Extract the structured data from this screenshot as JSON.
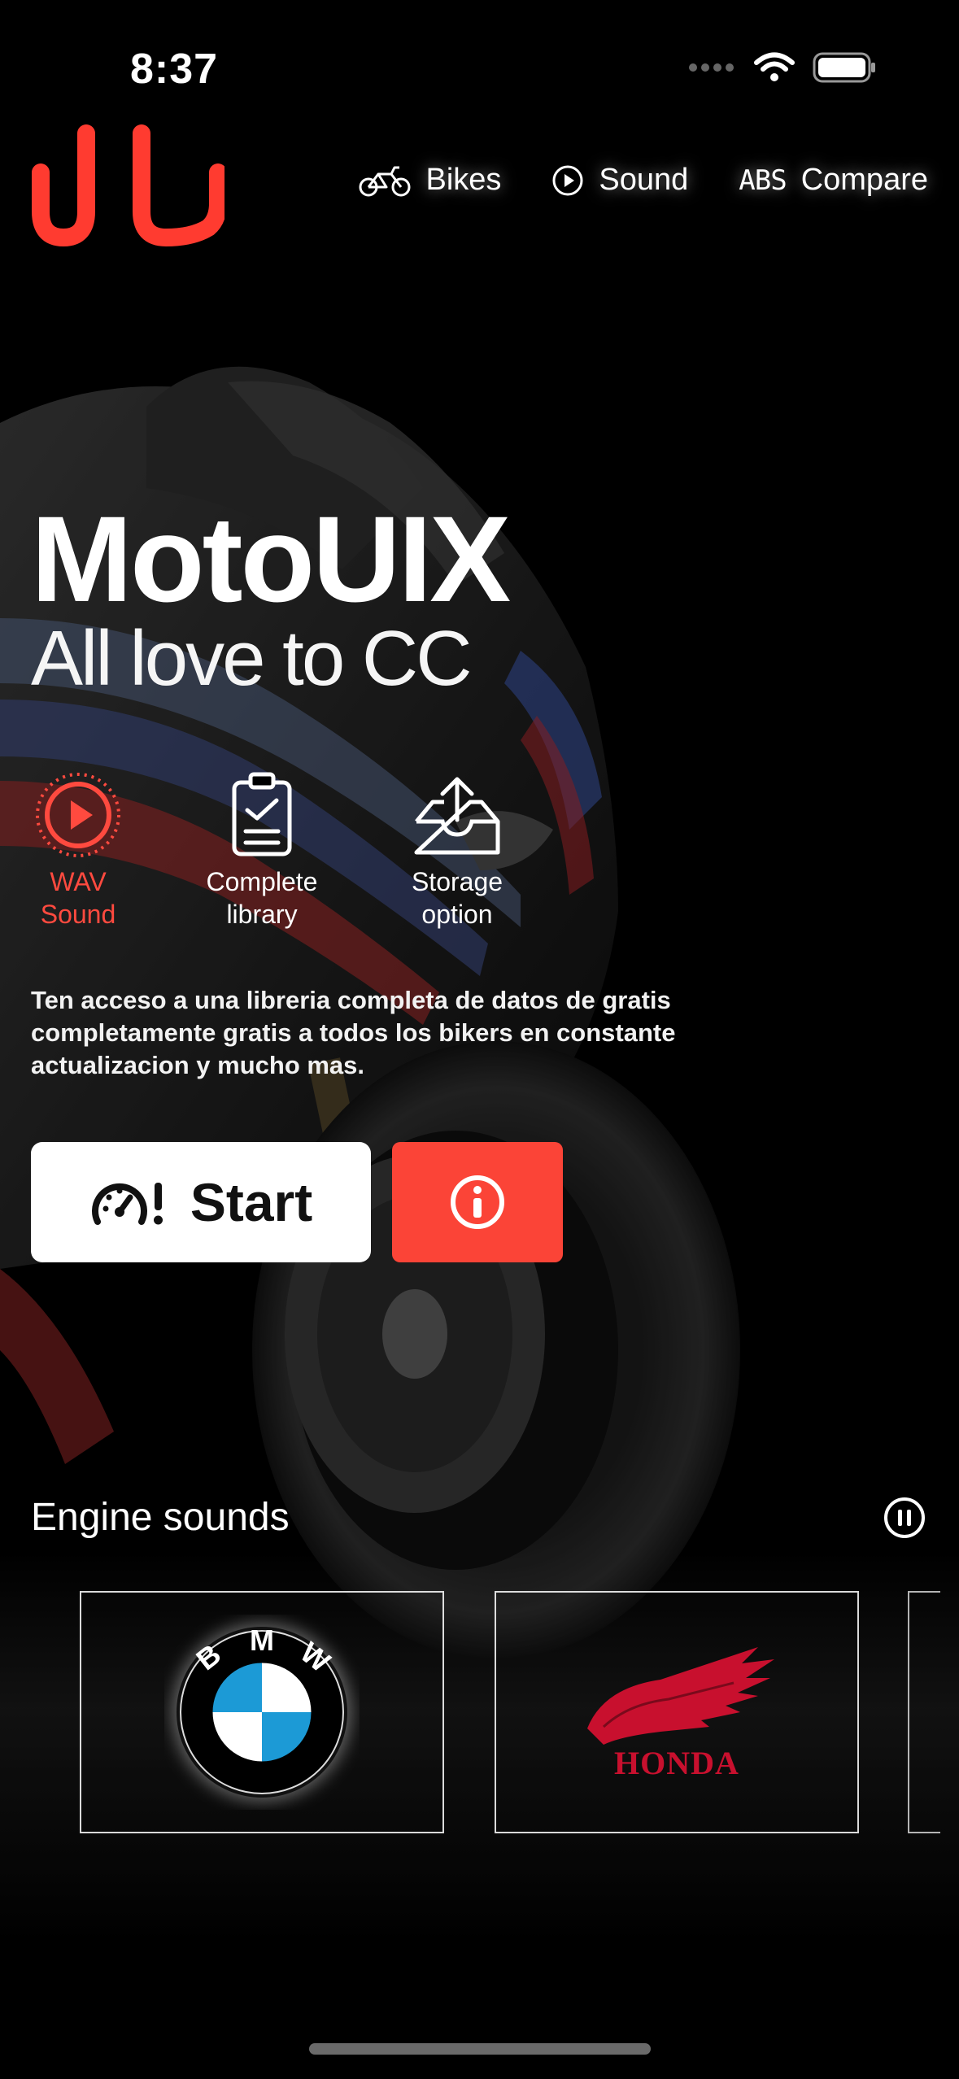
{
  "status": {
    "time": "8:37"
  },
  "nav": [
    {
      "label": "Bikes",
      "icon": "bicycle-icon"
    },
    {
      "label": "Sound",
      "icon": "play-circle-icon"
    },
    {
      "label": "Compare",
      "icon": "abs-icon",
      "icon_text": "ABS"
    }
  ],
  "hero": {
    "title": "MotoUIX",
    "subtitle": "All love to CC"
  },
  "features": [
    {
      "line1": "WAV",
      "line2": "Sound",
      "icon": "play-circle-dotted-icon"
    },
    {
      "line1": "Complete",
      "line2": "library",
      "icon": "clipboard-check-icon"
    },
    {
      "line1": "Storage",
      "line2": "option",
      "icon": "tray-upload-icon"
    }
  ],
  "description": "Ten acceso a una libreria completa de datos de  gratis completamente gratis a todos los bikers en constante actualizacion y mucho mas.",
  "actions": {
    "start_label": "Start",
    "start_icon": "gauge-alert-icon",
    "info_icon": "info-circle-icon"
  },
  "engine_sounds": {
    "title": "Engine sounds",
    "control_icon": "pause-circle-icon",
    "brands": [
      {
        "name": "BMW",
        "letters": [
          "B",
          "M",
          "W"
        ]
      },
      {
        "name": "HONDA",
        "wordmark": "HONDA"
      }
    ]
  },
  "colors": {
    "accent": "#fb4437",
    "background": "#000000",
    "logo": "#ff3b30"
  }
}
